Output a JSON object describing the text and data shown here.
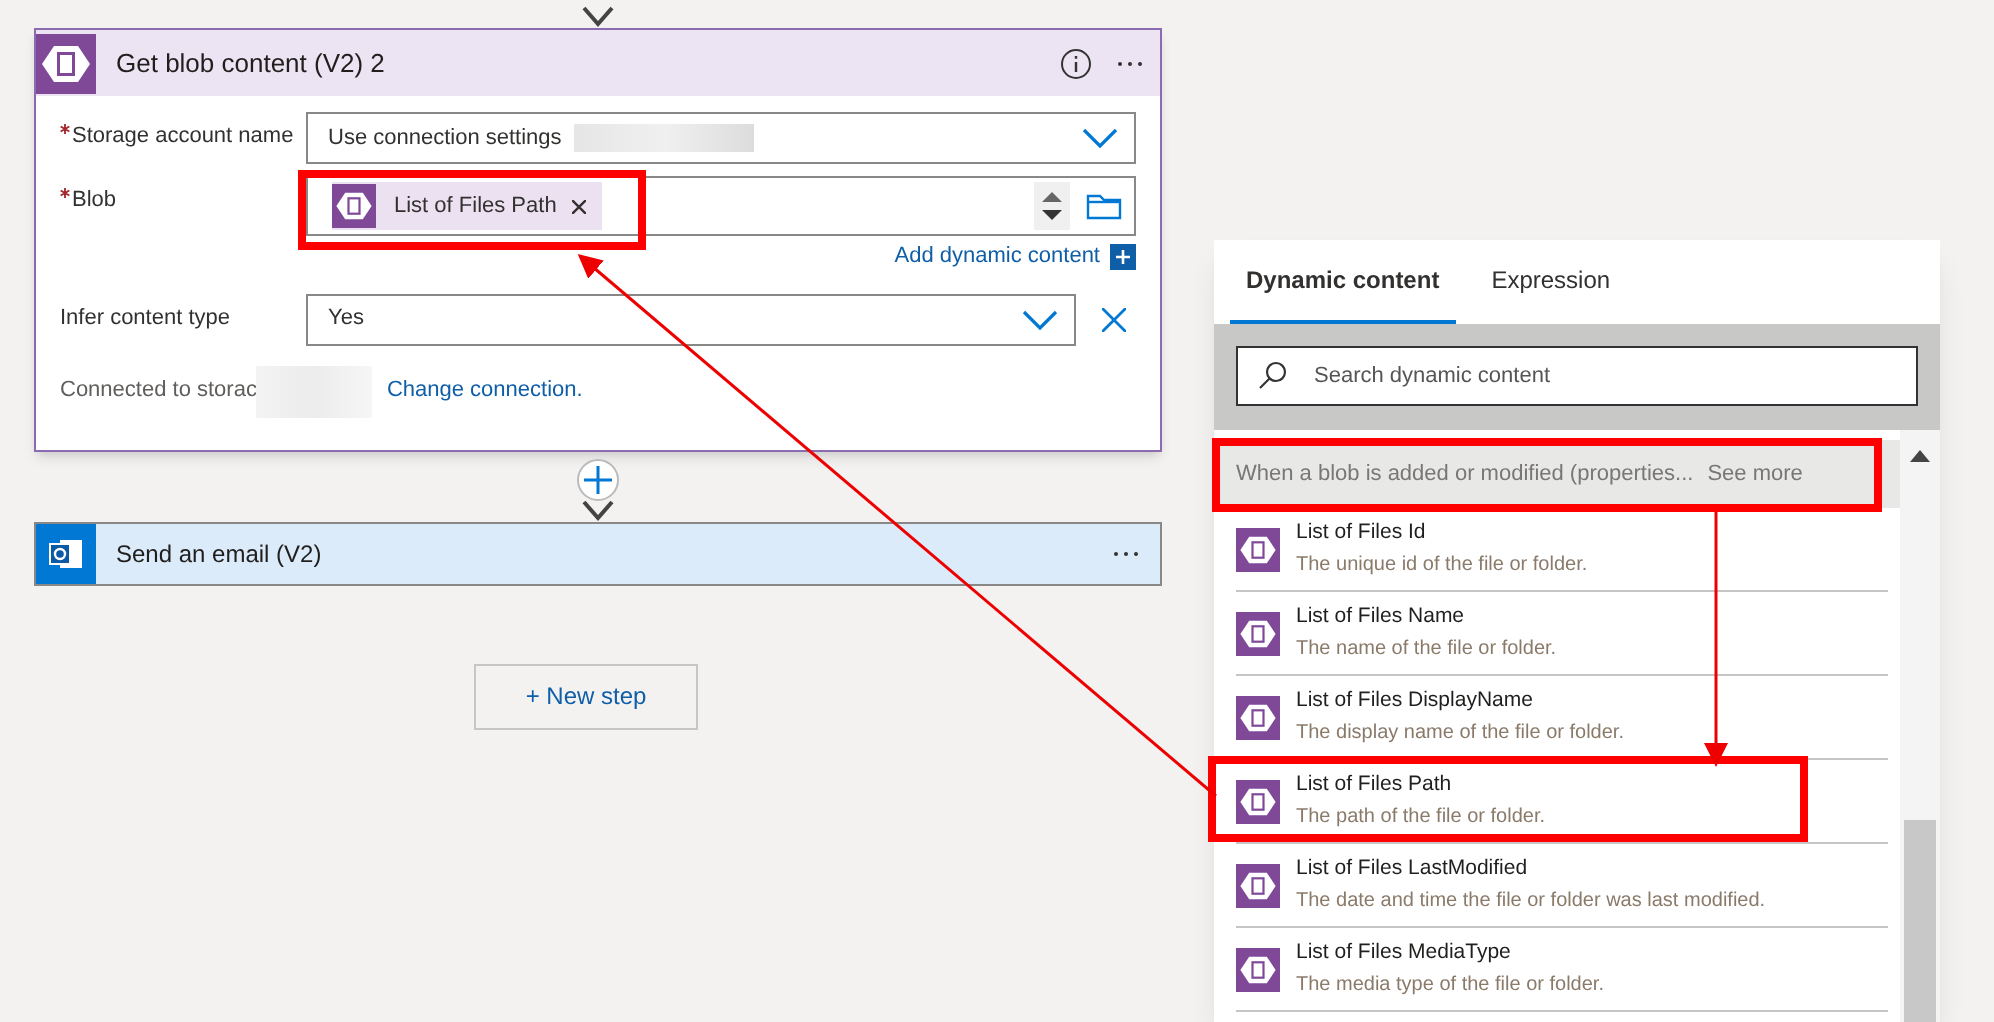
{
  "action_card": {
    "title": "Get blob content (V2) 2",
    "fields": [
      {
        "kind": "dropdown",
        "label": "Storage account name",
        "required": true,
        "value": "Use connection settings",
        "removable": false
      },
      {
        "kind": "token",
        "label": "Blob",
        "required": true,
        "token": "List of Files Path"
      },
      {
        "kind": "dropdown",
        "label": "Infer content type",
        "required": false,
        "value": "Yes",
        "removable": true
      }
    ],
    "add_dynamic_content": "Add dynamic content",
    "connection_text": "Connected to storac",
    "change_connection": "Change connection."
  },
  "next_card": {
    "title": "Send an email (V2)"
  },
  "new_step": "+ New step",
  "dynamic_panel": {
    "tabs": [
      {
        "label": "Dynamic content",
        "selected": true
      },
      {
        "label": "Expression",
        "selected": false
      }
    ],
    "search": {
      "placeholder": "Search dynamic content"
    },
    "group": {
      "title": "When a blob is added or modified (properties...",
      "see_more": "See more"
    },
    "items": [
      {
        "name": "List of Files Id",
        "description": "The unique id of the file or folder."
      },
      {
        "name": "List of Files Name",
        "description": "The name of the file or folder."
      },
      {
        "name": "List of Files DisplayName",
        "description": "The display name of the file or folder."
      },
      {
        "name": "List of Files Path",
        "description": "The path of the file or folder."
      },
      {
        "name": "List of Files LastModified",
        "description": "The date and time the file or folder was last modified."
      },
      {
        "name": "List of Files MediaType",
        "description": "The media type of the file or folder."
      }
    ]
  }
}
